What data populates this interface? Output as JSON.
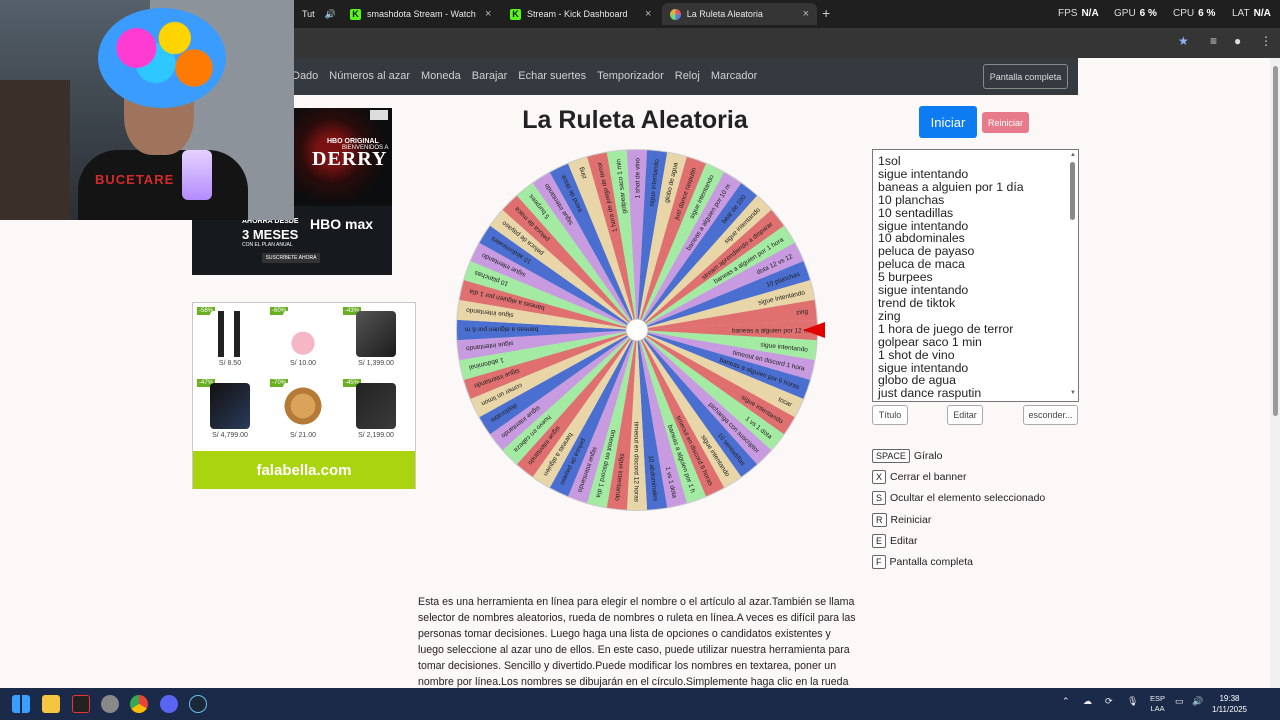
{
  "browser": {
    "tabs": [
      {
        "label": "Tut",
        "active": false
      },
      {
        "label": "smashdota Stream - Watch Live",
        "active": false
      },
      {
        "label": "Stream - Kick Dashboard",
        "active": false
      },
      {
        "label": "La Ruleta Aleatoria",
        "active": true
      }
    ],
    "new_tab": "+",
    "perf": {
      "fps_label": "FPS",
      "fps": "N/A",
      "gpu_label": "GPU",
      "gpu": "6 %",
      "cpu_label": "CPU",
      "cpu": "6 %",
      "lat_label": "LAT",
      "lat": "N/A"
    }
  },
  "nav": {
    "links": [
      "Dado",
      "Números al azar",
      "Moneda",
      "Barajar",
      "Echar suertes",
      "Temporizador",
      "Reloj",
      "Marcador"
    ],
    "fullscreen": "Pantalla completa"
  },
  "ad_hbo": {
    "brand": "HBO ORIGINAL",
    "welcome": "BIENVENIDOS A",
    "show": "DERRY",
    "offer_line1": "AHORRA DESDE",
    "offer_line2": "3 MESES",
    "offer_line3": "CON EL PLAN ANUAL",
    "logo": "HBO max",
    "cta": "SUSCRÍBETE AHORA"
  },
  "ad_falabella": {
    "products": [
      {
        "discount": "-58%",
        "price": "S/ 8.50"
      },
      {
        "discount": "-60%",
        "price": "S/ 10.00"
      },
      {
        "discount": "-43%",
        "price": "S/ 1,399.00"
      },
      {
        "discount": "-47%",
        "price": "S/ 4,799.00"
      },
      {
        "discount": "-70%",
        "price": "S/ 21.00"
      },
      {
        "discount": "-45%",
        "price": "S/ 2,199.00"
      }
    ],
    "logo": "falabella.com"
  },
  "wheel": {
    "title": "La Ruleta Aleatoria",
    "start_button": "Iniciar",
    "reset_button": "Reiniciar",
    "segment_colors": [
      "#e07070",
      "#a3eaa3",
      "#c89be0",
      "#4a6fd0",
      "#e8d6a8"
    ]
  },
  "entries_visible": [
    "1sol",
    "sigue intentando",
    "baneas a alguien por 1 día",
    "10 planchas",
    "10 sentadillas",
    "sigue intentando",
    "10 abdominales",
    "peluca de payaso",
    "peluca de maca",
    "5 burpees",
    "sigue intentando",
    "trend de tiktok",
    "zing",
    "1 hora de juego de terror",
    "golpear saco 1 min",
    "1 shot de vino",
    "sigue intentando",
    "globo de agua",
    "just dance rasputin"
  ],
  "wheel_labels": [
    "baneas a alguien por 12 m",
    "sigue intentando",
    "timeout en discord 1 hora",
    "baneas a alguien por 6 horas",
    "tocar",
    "sigue intentando",
    "1 vs 1 dota",
    "pichanga con suscriptor",
    "10 sentadillas",
    "sigue intentando",
    "timeout en discord 6 horas",
    "baneas a alguien por 1 h",
    "1 vs 1 dota",
    "10 abdominales",
    "timeout en discord 12 horas",
    "sigue intentando",
    "timeout en discord 1 día",
    "sigue intentando",
    "peluca de payaso",
    "baneas a alguien",
    "sigue intentando",
    "huevo en cabeza",
    "sigue intentando",
    "deplorable",
    "comer un limon",
    "sigue intentando",
    "1 abdominal",
    "sigue intentando",
    "baneas a alguien por 6 m",
    "sigue intentando",
    "baneas a alguien por 1 día",
    "10 planchas",
    "sigue intentando",
    "10 abdominales",
    "peluca de payaso",
    "peluca de maca",
    "5 burpees",
    "sigue intentando",
    "trend de tiktok",
    "zing",
    "1 hora de juego de terror",
    "golpear saco 1 min",
    "1 shot de vino",
    "sigue intentando",
    "globo de agua",
    "just dance rasputin",
    "sigue intentando",
    "baneas a alguien por 10 m",
    "beat de 100",
    "sigue intentando",
    "stream aprendiendo a disparar",
    "baneas a alguien por 1 hora",
    "dota 12 vs 12",
    "10 planchas",
    "sigue intentando",
    "zing"
  ],
  "textarea_buttons": {
    "title": "Título",
    "edit": "Editar",
    "hide": "esconder..."
  },
  "shortcuts": [
    {
      "key": "SPACE",
      "label": "Gíralo"
    },
    {
      "key": "X",
      "label": "Cerrar el banner"
    },
    {
      "key": "S",
      "label": "Ocultar el elemento seleccionado"
    },
    {
      "key": "R",
      "label": "Reiniciar"
    },
    {
      "key": "E",
      "label": "Editar"
    },
    {
      "key": "F",
      "label": "Pantalla completa"
    }
  ],
  "description": "Esta es una herramienta en línea para elegir el nombre o el artículo al azar.También se llama selector de nombres aleatorios, rueda de nombres o ruleta en línea.A veces es difícil para las personas tomar decisiones. Luego haga una lista de opciones o candidatos existentes y luego seleccione al azar uno de ellos. En este caso, puede utilizar nuestra herramienta para tomar decisiones. Sencillo y divertido.Puede modificar los nombres en textarea, poner un nombre por línea.Los nombres se dibujarán en el círculo.Simplemente haga clic en la rueda",
  "webcam": {
    "shirt_text": "BUCETARE"
  },
  "taskbar": {
    "lang_line1": "ESP",
    "lang_line2": "LAA",
    "time": "19:38",
    "date": "1/11/2025"
  }
}
